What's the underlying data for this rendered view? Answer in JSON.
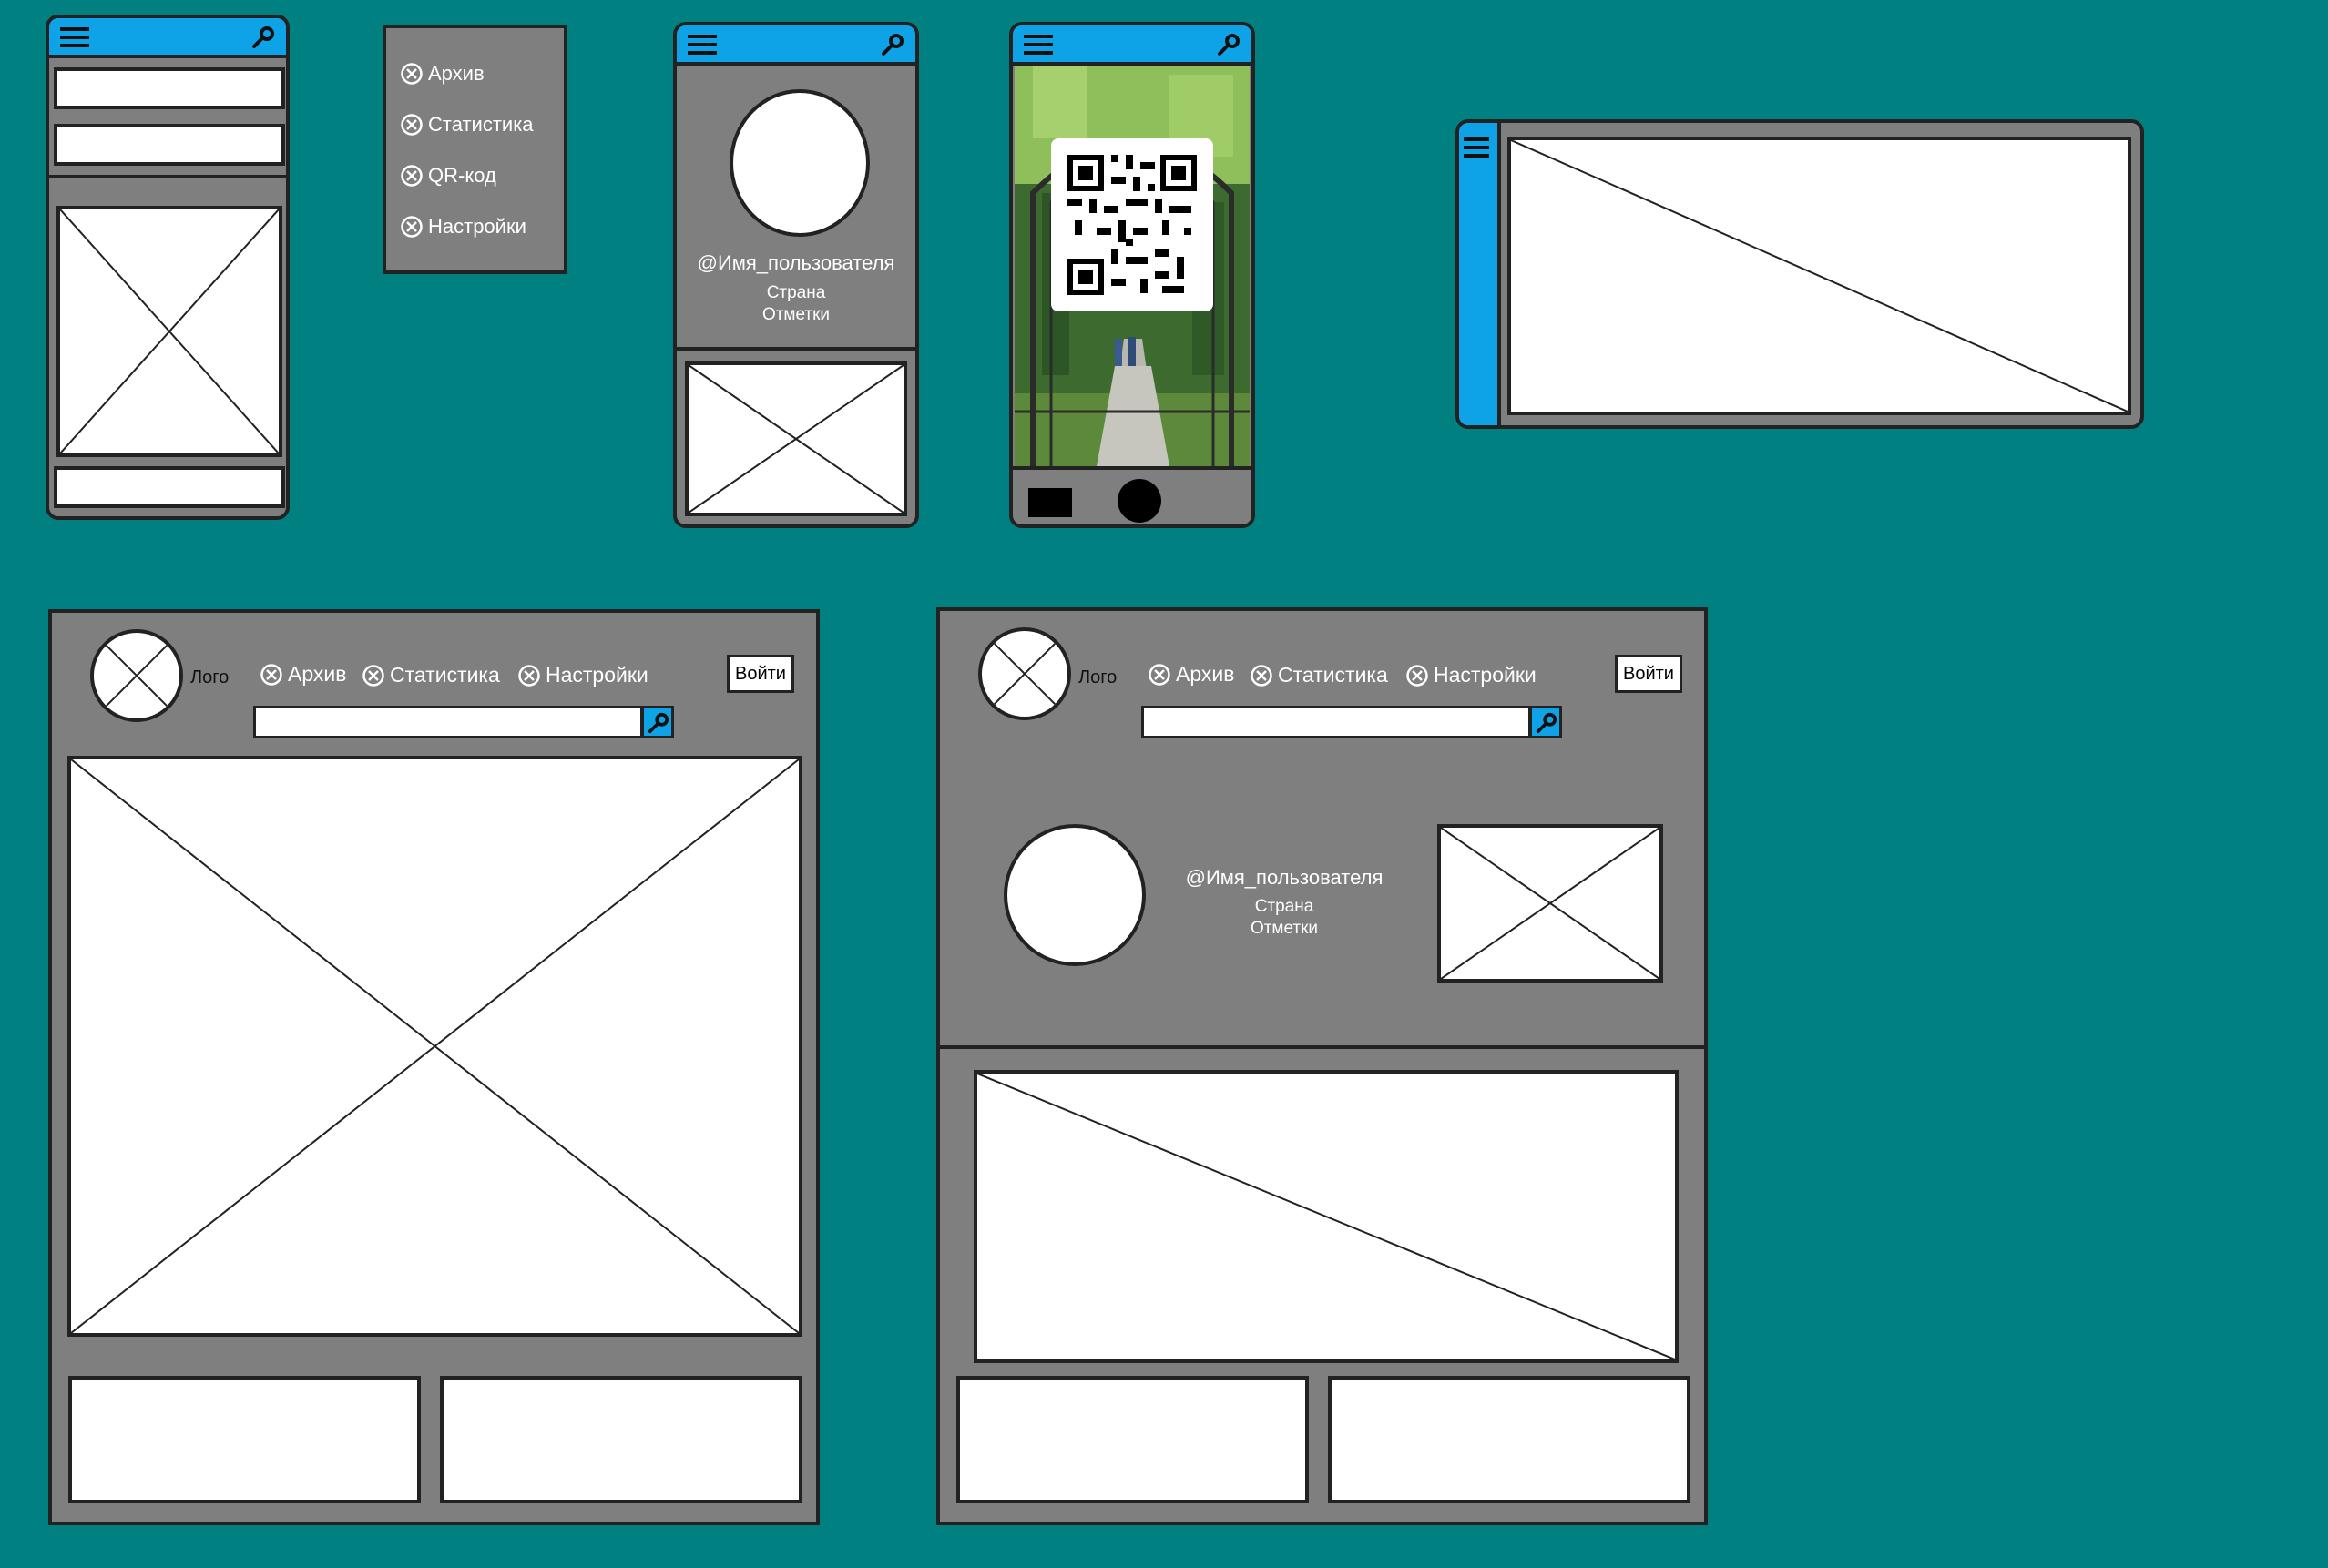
{
  "nav_items": [
    "Архив",
    "Статистика",
    "QR-код",
    "Настройки"
  ],
  "profile": {
    "username": "@Имя_пользователя",
    "country": "Страна",
    "marks": "Отметки"
  },
  "header": {
    "logo": "Лого",
    "links": [
      "Архив",
      "Статистика",
      "Настройки"
    ],
    "login": "Войти"
  },
  "colors": {
    "background": "#008080",
    "panel": "#7f7f7f",
    "accent": "#0ea2e6",
    "outline": "#222222"
  },
  "icons": {
    "menu": "hamburger-icon",
    "search": "search-key-icon",
    "nav": "circled-x-icon"
  }
}
